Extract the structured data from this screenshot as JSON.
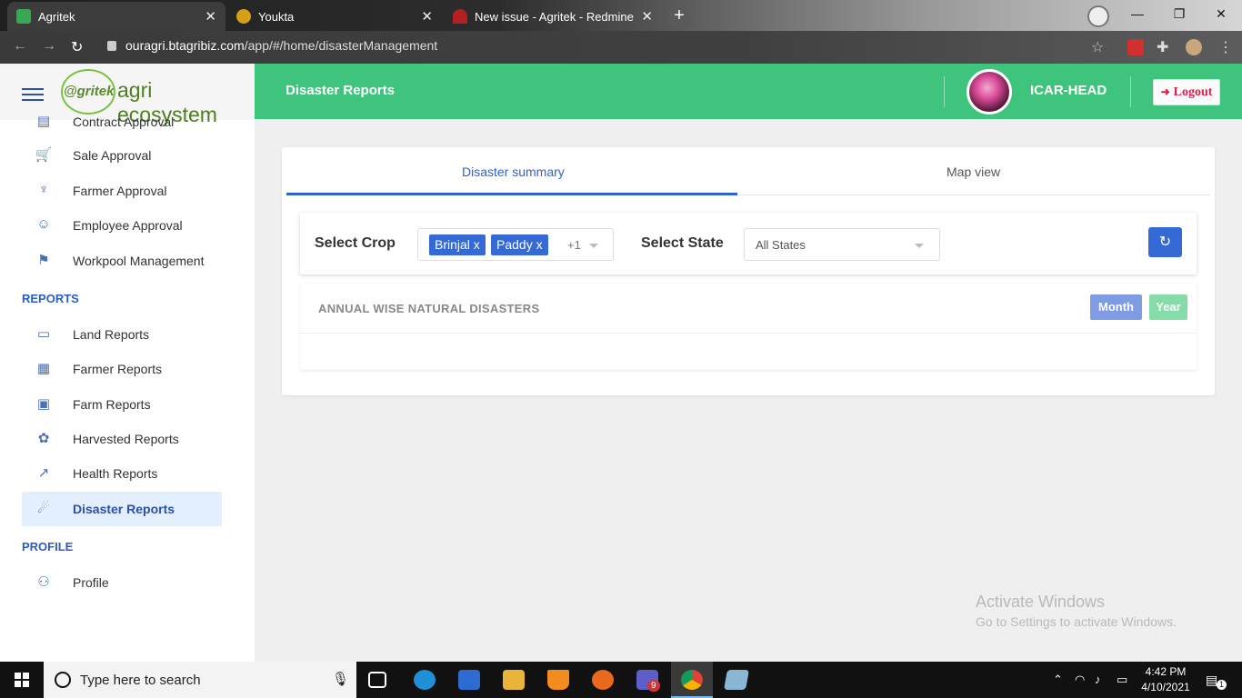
{
  "browser": {
    "tabs": [
      {
        "title": "Agritek",
        "favicon_color": "#3aa757"
      },
      {
        "title": "Youkta",
        "favicon_color": "#d4a017"
      },
      {
        "title": "New issue - Agritek - Redmine",
        "favicon_color": "#b32024"
      }
    ],
    "new_tab": "+",
    "url_host": "ouragri.btagribiz.com",
    "url_path": "/app/#/home/disasterManagement"
  },
  "sidebar": {
    "logo_small": "@gritek",
    "logo_text": "agri ecosystem",
    "items_top": [
      {
        "label": "Contract Approval",
        "icon": "contract-icon"
      },
      {
        "label": "Sale Approval",
        "icon": "cart-icon"
      },
      {
        "label": "Farmer Approval",
        "icon": "farmer-icon"
      },
      {
        "label": "Employee Approval",
        "icon": "employee-icon"
      },
      {
        "label": "Workpool Management",
        "icon": "workpool-icon"
      }
    ],
    "section_reports": "REPORTS",
    "items_reports": [
      {
        "label": "Land Reports",
        "icon": "land-icon"
      },
      {
        "label": "Farmer Reports",
        "icon": "farmer-report-icon"
      },
      {
        "label": "Farm Reports",
        "icon": "farm-icon"
      },
      {
        "label": "Harvested Reports",
        "icon": "harvest-icon"
      },
      {
        "label": "Health Reports",
        "icon": "health-icon"
      },
      {
        "label": "Disaster Reports",
        "icon": "disaster-icon"
      }
    ],
    "section_profile": "PROFILE",
    "items_profile": [
      {
        "label": "Profile",
        "icon": "profile-icon"
      }
    ]
  },
  "header": {
    "title": "Disaster Reports",
    "username": "ICAR-HEAD",
    "logout_label": "Logout"
  },
  "tabs": {
    "summary": "Disaster summary",
    "map": "Map view"
  },
  "filters": {
    "crop_label": "Select Crop",
    "crop_chips": [
      "Brinjal",
      "Paddy"
    ],
    "chip_remove": "x",
    "crop_more": "+1",
    "state_label": "Select State",
    "state_value": "All States"
  },
  "disasters": {
    "heading": "ANNUAL WISE NATURAL DISASTERS",
    "month_label": "Month",
    "year_label": "Year"
  },
  "watermark": {
    "line1": "Activate Windows",
    "line2": "Go to Settings to activate Windows."
  },
  "taskbar": {
    "search_placeholder": "Type here to search",
    "teams_badge": "9",
    "time": "4:42 PM",
    "date": "4/10/2021",
    "notification_count": "1"
  },
  "colors": {
    "header_green": "#3ec47c",
    "primary_blue": "#3569d6",
    "logout_red": "#d6204b"
  }
}
